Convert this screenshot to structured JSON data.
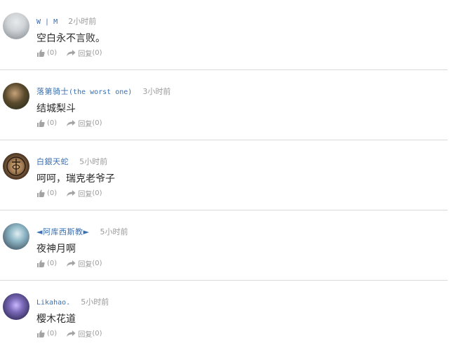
{
  "comments": [
    {
      "username": "W | M",
      "time": "2小时前",
      "content": "空白永不言败。",
      "like_count": "(0)",
      "reply_label": "回复",
      "reply_count": "(0)",
      "avatar_colors": [
        "#cfd3d6",
        "#7e858c"
      ]
    },
    {
      "username": "落第骑士",
      "username_extra": "(the worst one)",
      "time": "3小时前",
      "content": "结城梨斗",
      "like_count": "(0)",
      "reply_label": "回复",
      "reply_count": "(0)",
      "avatar_colors": [
        "#5a4a2d",
        "#1e2616"
      ]
    },
    {
      "username": "白銀天蛇",
      "time": "5小时前",
      "content": "呵呵，瑞克老爷子",
      "like_count": "(0)",
      "reply_label": "回复",
      "reply_count": "(0)",
      "avatar_colors": [
        "#a07a52",
        "#2b1d12"
      ]
    },
    {
      "username": "◄阿库西斯教►",
      "time": "5小时前",
      "content": "夜神月啊",
      "like_count": "(0)",
      "reply_label": "回复",
      "reply_count": "(0)",
      "avatar_colors": [
        "#8fb7c6",
        "#2c3a4a"
      ]
    },
    {
      "username": "Likahao.",
      "time": "5小时前",
      "content": "樱木花道",
      "like_count": "(0)",
      "reply_label": "回复",
      "reply_count": "(0)",
      "avatar_colors": [
        "#7a6ab8",
        "#1a1438"
      ]
    }
  ],
  "colors": {
    "username": "#3a6fb0",
    "muted": "#9a9a9a",
    "divider": "#d9d9d9",
    "text": "#2a2a2a"
  }
}
